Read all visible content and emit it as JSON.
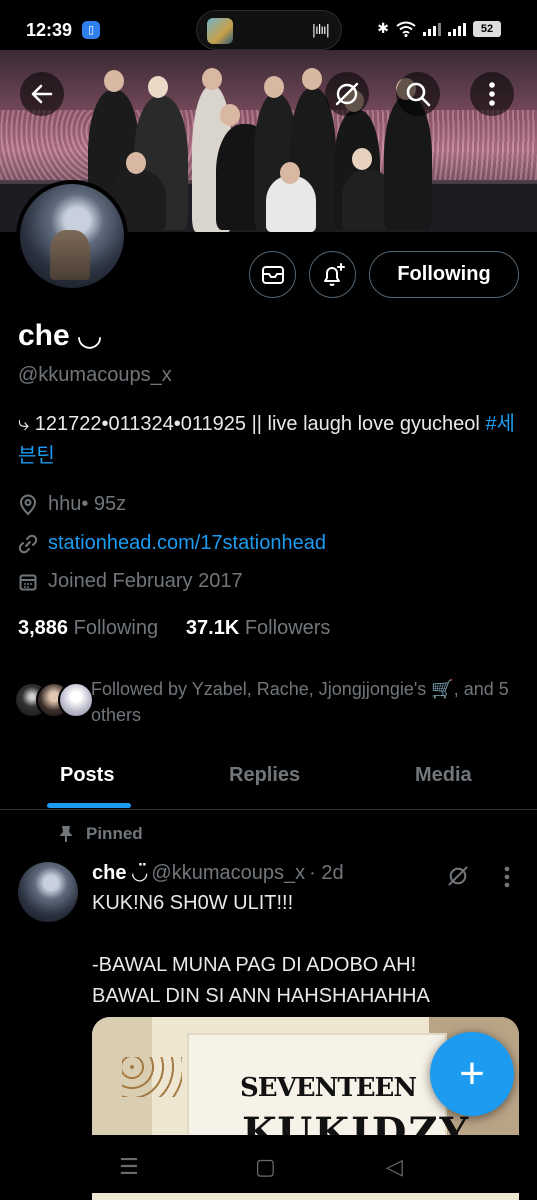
{
  "status_bar": {
    "time": "12:39",
    "battery": "52"
  },
  "header": {
    "back_icon": "arrow-left-icon",
    "grok_icon": "grok-icon",
    "search_icon": "search-icon",
    "more_icon": "more-vertical-icon"
  },
  "profile": {
    "name": "che ◡",
    "handle": "@kkumacoups_x",
    "bio_main": "⤷ 121722•011324•011925 || live laugh love gyucheol ",
    "bio_tag": "#세븐틴",
    "location": "hhu• 95z",
    "link": "stationhead.com/17stationhead",
    "joined": "Joined February 2017",
    "following_count": "3,886",
    "following_label": "Following",
    "followers_count": "37.1K",
    "followers_label": "Followers",
    "followed_by": "Followed by Yzabel, Rache, Jjongjjongie's 🛒, and 5 others"
  },
  "actions": {
    "follow_label": "Following"
  },
  "tabs": [
    {
      "label": "Posts",
      "active": true
    },
    {
      "label": "Replies",
      "active": false
    },
    {
      "label": "Media",
      "active": false
    }
  ],
  "tweet": {
    "pinned_label": "Pinned",
    "name": "che ◡̈",
    "handle": "@kkumacoups_x",
    "time": "· 2d",
    "text": "KUK!N6 SH0W ULIT!!!\n\n-BAWAL MUNA PAG DI ADOBO AH!\nBAWAL DIN SI ANN HAHSHAHAHHA",
    "media_brand": "SEVENTEEN",
    "media_brand2": "KUKIDZY"
  },
  "fab_label": "+",
  "colors": {
    "accent": "#1d9bf0",
    "muted": "#71767b",
    "background": "#000000"
  }
}
